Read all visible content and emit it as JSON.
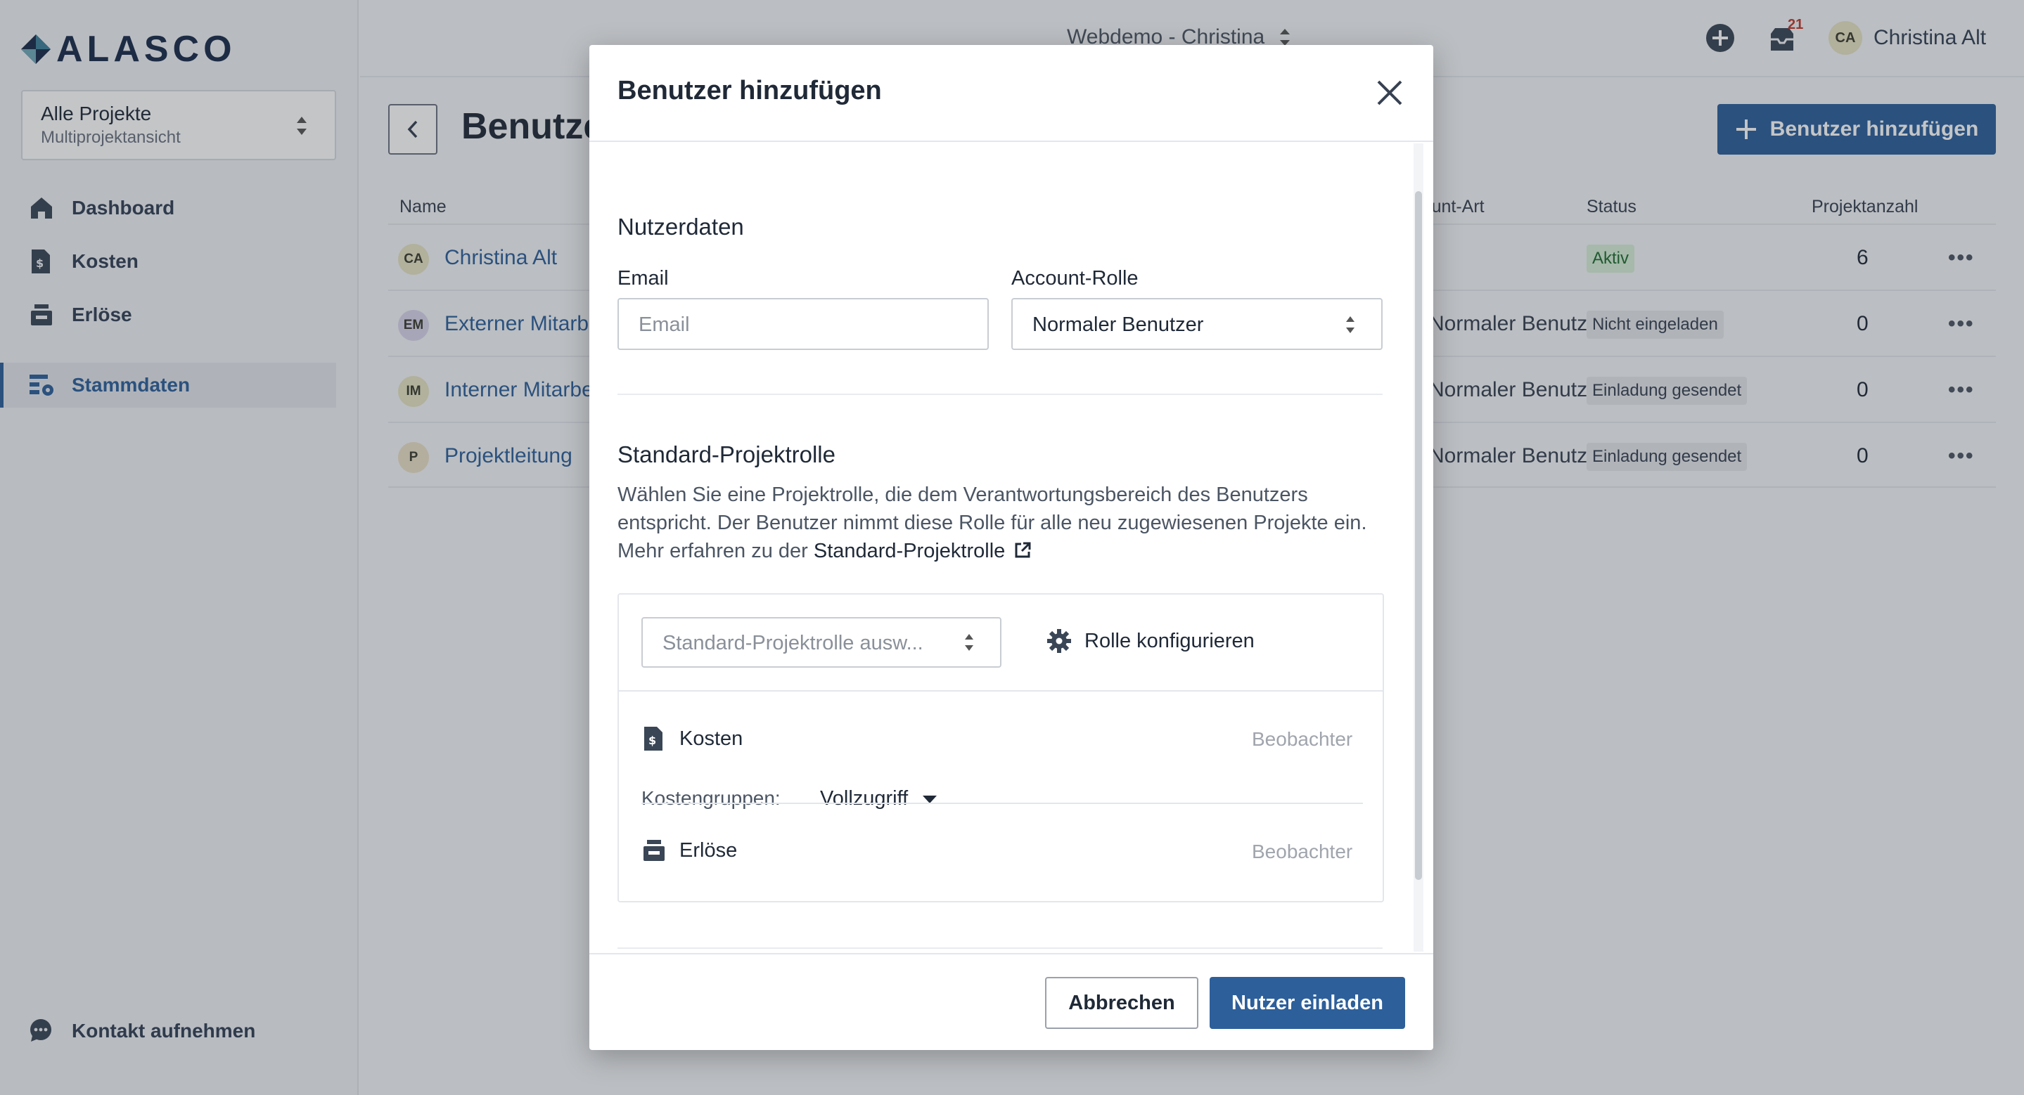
{
  "app": {
    "logo_text": "ALASCO",
    "project_selector": {
      "title": "Alle Projekte",
      "subtitle": "Multiprojektansicht"
    },
    "nav": [
      {
        "label": "Dashboard",
        "icon": "home-icon"
      },
      {
        "label": "Kosten",
        "icon": "cost-document-icon"
      },
      {
        "label": "Erlöse",
        "icon": "cash-register-icon"
      },
      {
        "label": "Stammdaten",
        "icon": "master-data-icon",
        "active": true
      }
    ],
    "contact_label": "Kontakt aufnehmen"
  },
  "header": {
    "workspace": "Webdemo - Christina",
    "notification_count": "21",
    "user_initials": "CA",
    "user_name": "Christina Alt"
  },
  "page": {
    "title": "Benutzer",
    "add_button_label": "Benutzer hinzufügen",
    "columns": {
      "name": "Name",
      "role": "Account-Art",
      "status": "Status",
      "count": "Projektanzahl"
    },
    "rows": [
      {
        "initials": "CA",
        "name": "Christina Alt",
        "role": "",
        "status": "Aktiv",
        "count": "6",
        "avatar_color": "#e6e4c4"
      },
      {
        "initials": "EM",
        "name": "Externer Mitarbeiter",
        "role": "Normaler Benutzer",
        "status": "Nicht eingeladen",
        "count": "0",
        "avatar_color": "#d9d4ec"
      },
      {
        "initials": "IM",
        "name": "Interner Mitarbeiter",
        "role": "Normaler Benutzer",
        "status": "Einladung gesendet",
        "count": "0",
        "avatar_color": "#e6e4c4"
      },
      {
        "initials": "P",
        "name": "Projektleitung",
        "role": "Normaler Benutzer",
        "status": "Einladung gesendet",
        "count": "0",
        "avatar_color": "#eadfc8"
      }
    ]
  },
  "modal": {
    "title": "Benutzer hinzufügen",
    "user_data_title": "Nutzerdaten",
    "email_label": "Email",
    "email_placeholder": "Email",
    "account_role_label": "Account-Rolle",
    "account_role_value": "Normaler Benutzer",
    "default_role_title": "Standard-Projektrolle",
    "default_role_desc": "Wählen Sie eine Projektrolle, die dem Verantwortungsbereich des Benutzers entspricht. Der Benutzer nimmt diese Rolle für alle neu zugewiesenen Projekte ein. Mehr erfahren zu der ",
    "default_role_link": "Standard-Projektrolle",
    "role_select_placeholder": "Standard-Projektrolle ausw...",
    "configure_role_label": "Rolle konfigurieren",
    "permissions": [
      {
        "label": "Kosten",
        "level": "Beobachter"
      },
      {
        "label": "Erlöse",
        "level": "Beobachter"
      }
    ],
    "cost_groups_label": "Kostengruppen:",
    "cost_groups_value": "Vollzugriff",
    "cancel_label": "Abbrechen",
    "invite_label": "Nutzer einladen"
  },
  "colors": {
    "primary": "#2d5f9a",
    "active_status": "#d7efd9"
  }
}
